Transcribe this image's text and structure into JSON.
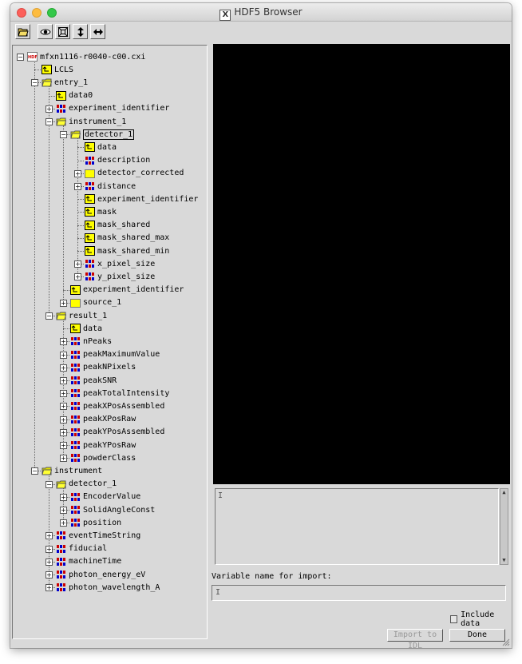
{
  "window": {
    "title": "HDF5 Browser",
    "title_icon": "X"
  },
  "toolbar": {
    "buttons": [
      "open-folder-icon",
      "eye-icon",
      "fit-frame-icon",
      "move-vertical-icon",
      "move-horizontal-icon"
    ]
  },
  "tree": {
    "nodes": [
      {
        "id": "n0",
        "label": "mfxn1116-r0040-c00.cxi",
        "depth": 0,
        "icon": "hdf-file",
        "exp": "minus"
      },
      {
        "id": "n1",
        "label": "LCLS",
        "depth": 1,
        "icon": "dataset",
        "exp": ""
      },
      {
        "id": "n2",
        "label": "entry_1",
        "depth": 1,
        "icon": "group-open",
        "exp": "minus"
      },
      {
        "id": "n3",
        "label": "data0",
        "depth": 2,
        "icon": "dataset",
        "exp": ""
      },
      {
        "id": "n4",
        "label": "experiment_identifier",
        "depth": 2,
        "icon": "array",
        "exp": "plus"
      },
      {
        "id": "n5",
        "label": "instrument_1",
        "depth": 2,
        "icon": "group-open",
        "exp": "minus"
      },
      {
        "id": "n6",
        "label": "detector_1",
        "depth": 3,
        "icon": "group-open",
        "exp": "minus",
        "selected": true
      },
      {
        "id": "n7",
        "label": "data",
        "depth": 4,
        "icon": "dataset",
        "exp": ""
      },
      {
        "id": "n8",
        "label": "description",
        "depth": 4,
        "icon": "array",
        "exp": ""
      },
      {
        "id": "n9",
        "label": "detector_corrected",
        "depth": 4,
        "icon": "group",
        "exp": "plus"
      },
      {
        "id": "n10",
        "label": "distance",
        "depth": 4,
        "icon": "array",
        "exp": "plus"
      },
      {
        "id": "n11",
        "label": "experiment_identifier",
        "depth": 4,
        "icon": "dataset",
        "exp": ""
      },
      {
        "id": "n12",
        "label": "mask",
        "depth": 4,
        "icon": "dataset",
        "exp": ""
      },
      {
        "id": "n13",
        "label": "mask_shared",
        "depth": 4,
        "icon": "dataset",
        "exp": ""
      },
      {
        "id": "n14",
        "label": "mask_shared_max",
        "depth": 4,
        "icon": "dataset",
        "exp": ""
      },
      {
        "id": "n15",
        "label": "mask_shared_min",
        "depth": 4,
        "icon": "dataset",
        "exp": ""
      },
      {
        "id": "n16",
        "label": "x_pixel_size",
        "depth": 4,
        "icon": "array",
        "exp": "plus"
      },
      {
        "id": "n17",
        "label": "y_pixel_size",
        "depth": 4,
        "icon": "array",
        "exp": "plus"
      },
      {
        "id": "n18",
        "label": "experiment_identifier",
        "depth": 3,
        "icon": "dataset",
        "exp": ""
      },
      {
        "id": "n19",
        "label": "source_1",
        "depth": 3,
        "icon": "group",
        "exp": "plus"
      },
      {
        "id": "n20",
        "label": "result_1",
        "depth": 2,
        "icon": "group-open",
        "exp": "minus"
      },
      {
        "id": "n21",
        "label": "data",
        "depth": 3,
        "icon": "dataset",
        "exp": ""
      },
      {
        "id": "n22",
        "label": "nPeaks",
        "depth": 3,
        "icon": "array",
        "exp": "plus"
      },
      {
        "id": "n23",
        "label": "peakMaximumValue",
        "depth": 3,
        "icon": "array",
        "exp": "plus"
      },
      {
        "id": "n24",
        "label": "peakNPixels",
        "depth": 3,
        "icon": "array",
        "exp": "plus"
      },
      {
        "id": "n25",
        "label": "peakSNR",
        "depth": 3,
        "icon": "array",
        "exp": "plus"
      },
      {
        "id": "n26",
        "label": "peakTotalIntensity",
        "depth": 3,
        "icon": "array",
        "exp": "plus"
      },
      {
        "id": "n27",
        "label": "peakXPosAssembled",
        "depth": 3,
        "icon": "array",
        "exp": "plus"
      },
      {
        "id": "n28",
        "label": "peakXPosRaw",
        "depth": 3,
        "icon": "array",
        "exp": "plus"
      },
      {
        "id": "n29",
        "label": "peakYPosAssembled",
        "depth": 3,
        "icon": "array",
        "exp": "plus"
      },
      {
        "id": "n30",
        "label": "peakYPosRaw",
        "depth": 3,
        "icon": "array",
        "exp": "plus"
      },
      {
        "id": "n31",
        "label": "powderClass",
        "depth": 3,
        "icon": "array",
        "exp": "plus"
      },
      {
        "id": "n32",
        "label": "instrument",
        "depth": 1,
        "icon": "group-open",
        "exp": "minus"
      },
      {
        "id": "n33",
        "label": "detector_1",
        "depth": 2,
        "icon": "group-open",
        "exp": "minus"
      },
      {
        "id": "n34",
        "label": "EncoderValue",
        "depth": 3,
        "icon": "array",
        "exp": "plus"
      },
      {
        "id": "n35",
        "label": "SolidAngleConst",
        "depth": 3,
        "icon": "array",
        "exp": "plus"
      },
      {
        "id": "n36",
        "label": "position",
        "depth": 3,
        "icon": "array",
        "exp": "plus"
      },
      {
        "id": "n37",
        "label": "eventTimeString",
        "depth": 2,
        "icon": "array",
        "exp": "plus"
      },
      {
        "id": "n38",
        "label": "fiducial",
        "depth": 2,
        "icon": "array",
        "exp": "plus"
      },
      {
        "id": "n39",
        "label": "machineTime",
        "depth": 2,
        "icon": "array",
        "exp": "plus"
      },
      {
        "id": "n40",
        "label": "photon_energy_eV",
        "depth": 2,
        "icon": "array",
        "exp": "plus"
      },
      {
        "id": "n41",
        "label": "photon_wavelength_A",
        "depth": 2,
        "icon": "array",
        "exp": "plus"
      }
    ]
  },
  "import": {
    "variable_label": "Variable name for import:",
    "variable_value": "",
    "include_data_label": "Include data",
    "include_data_checked": false,
    "import_button": "Import to IDL",
    "done_button": "Done"
  },
  "colors": {
    "canvas": "#000000",
    "folder_yellow": "#ffff00",
    "array_red": "#cc0000",
    "array_blue": "#0000cc"
  }
}
